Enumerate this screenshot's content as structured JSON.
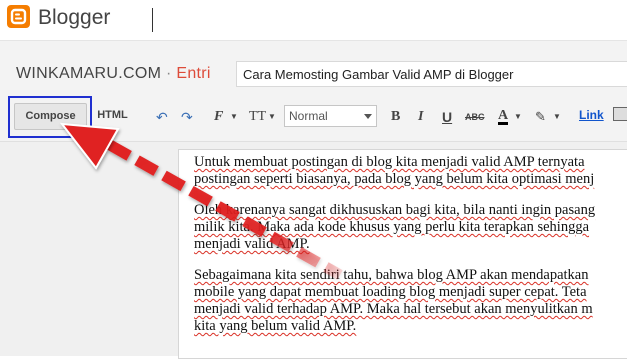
{
  "app": {
    "brand": "Blogger"
  },
  "header": {
    "blog_name": "WINKAMARU.COM",
    "separator": "·",
    "section": "Entri",
    "post_title": "Cara Memosting Gambar Valid AMP di Blogger"
  },
  "toolbar": {
    "compose_label": "Compose",
    "html_label": "HTML",
    "undo_icon": "undo-icon",
    "redo_icon": "redo-icon",
    "font_icon_label": "F",
    "size_icon_label": "TT",
    "format_value": "Normal",
    "bold_label": "B",
    "italic_label": "I",
    "underline_label": "U",
    "strike_label": "ABC",
    "text_color_label": "A",
    "link_label": "Link"
  },
  "colors": {
    "blogger_orange": "#f57d00",
    "entri_red": "#dd4b39",
    "highlight_blue": "#1f2fd0",
    "arrow_red": "#e02020",
    "link_blue": "#1155cc"
  },
  "content": {
    "p1_l1": "Untuk membuat postingan di blog kita menjadi valid AMP ternyata",
    "p1_l2": "postingan seperti biasanya, pada blog yang belum kita optimasi menj",
    "p2_l1": "Oleh karenanya sangat dikhususkan bagi kita, bila nanti ingin pasang",
    "p2_l2": "milik kita. Maka ada kode khusus yang perlu kita terapkan sehingga",
    "p2_l3": "menjadi valid AMP.",
    "p3_l1": "Sebagaimana kita sendiri tahu, bahwa blog AMP akan mendapatkan",
    "p3_l2": "mobile yang dapat membuat loading blog menjadi super cepat. Teta",
    "p3_l3": "menjadi valid terhadap AMP. Maka hal tersebut akan menyulitkan m",
    "p3_l4": "kita yang belum valid AMP."
  }
}
